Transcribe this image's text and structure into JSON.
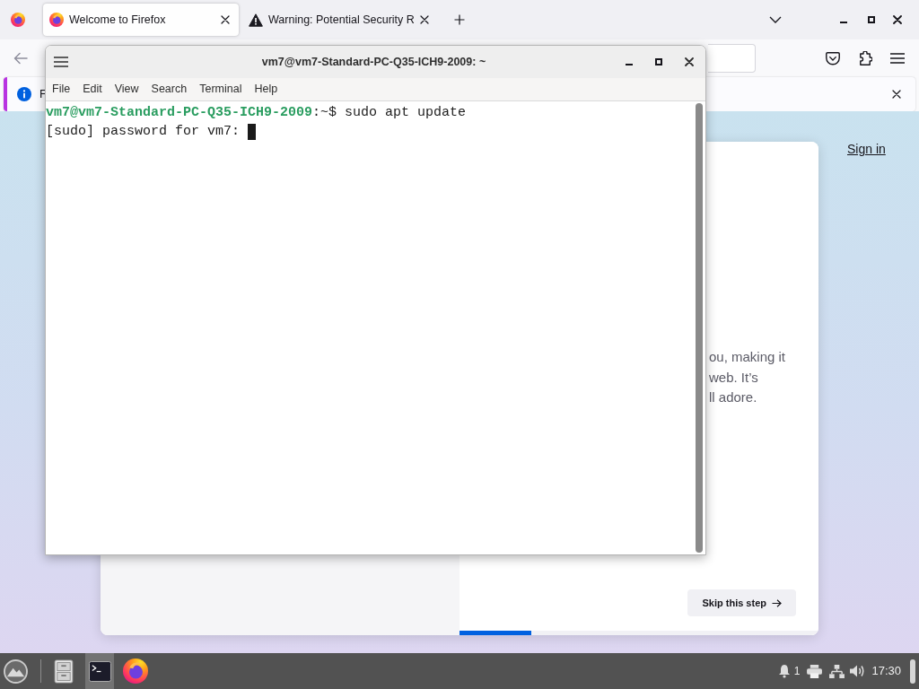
{
  "browser": {
    "tabs": [
      {
        "kind": "page",
        "title": "Welcome to Firefox",
        "selected": true
      },
      {
        "kind": "warning",
        "title": "Warning: Potential Security R",
        "selected": false
      }
    ],
    "notification": {
      "message": "F"
    },
    "page": {
      "sign_in": "Sign in",
      "text_lines": [
        "ou, making it",
        "web. It’s",
        "ll adore."
      ],
      "skip_button": "Skip this step",
      "progress": {
        "level": 0.2
      }
    }
  },
  "terminal": {
    "title": "vm7@vm7-Standard-PC-Q35-ICH9-2009: ~",
    "menu": [
      "File",
      "Edit",
      "View",
      "Search",
      "Terminal",
      "Help"
    ],
    "lines": [
      {
        "segments": [
          {
            "kind": "prompt",
            "text": "vm7@vm7-Standard-PC-Q35-ICH9-2009"
          },
          {
            "kind": "plain",
            "text": ":~$ sudo apt update"
          }
        ],
        "cursor": false
      },
      {
        "segments": [
          {
            "kind": "plain",
            "text": "[sudo] password for vm7:"
          }
        ],
        "cursor": true
      }
    ]
  },
  "taskbar": {
    "launchers": [
      {
        "kind": "files",
        "selected": false
      },
      {
        "kind": "terminal",
        "selected": true
      },
      {
        "kind": "browser",
        "selected": false
      }
    ],
    "notification_count": "1",
    "clock": "17:30"
  }
}
